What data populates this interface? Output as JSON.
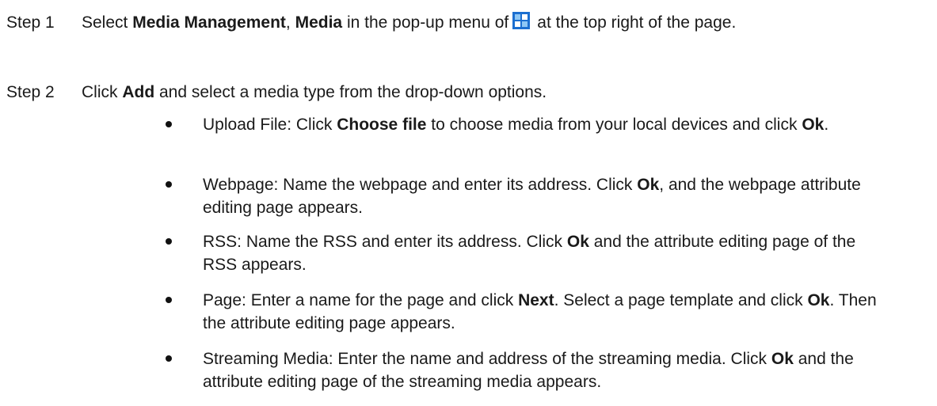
{
  "step1": {
    "label": "Step 1",
    "t1": "Select ",
    "b1": "Media Management",
    "t2": ", ",
    "b2": "Media",
    "t3": " in the pop-up menu of",
    "t4": "at the top right of the page."
  },
  "step2": {
    "label": "Step 2",
    "t1": "Click ",
    "b1": "Add",
    "t2": " and select a media type from the drop-down options."
  },
  "bullets": [
    {
      "t1": "Upload File: Click ",
      "b1": "Choose file",
      "t2": " to choose media from your local devices and click ",
      "b2": "Ok",
      "t3": "."
    },
    {
      "t1": "Webpage: Name the webpage and enter its address. Click ",
      "b1": "Ok",
      "t2": ", and the webpage attribute editing page appears."
    },
    {
      "t1": "RSS: Name the RSS and enter its address. Click ",
      "b1": "Ok",
      "t2": " and the attribute editing page of the RSS appears."
    },
    {
      "t1": "Page: Enter a name for the page and click ",
      "b1": "Next",
      "t2": ". Select a page template and click ",
      "b2": "Ok",
      "t3": ". Then the attribute editing page appears."
    },
    {
      "t1": "Streaming Media: Enter the name and address of the streaming media. Click ",
      "b1": "Ok",
      "t2": " and the attribute editing page of the streaming media appears."
    }
  ],
  "icon": {
    "name": "grid-menu-icon",
    "color_dark": "#1c6fd0",
    "color_light": "#8ec7f5"
  }
}
